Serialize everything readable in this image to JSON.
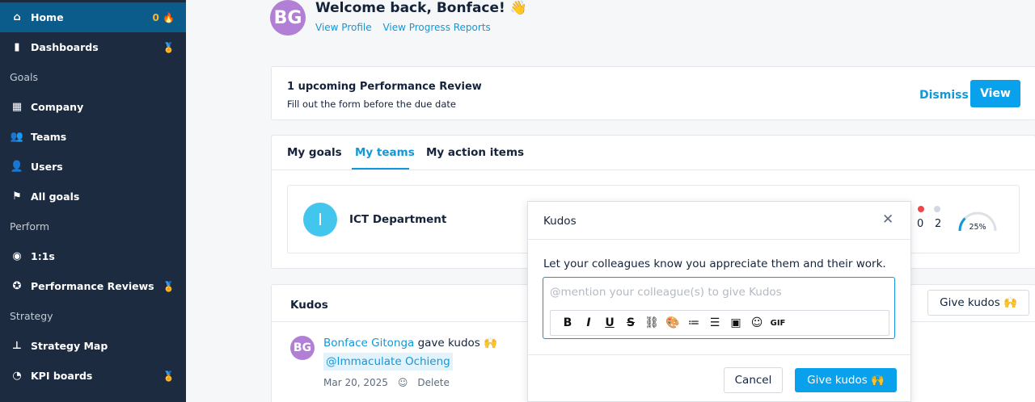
{
  "sidebar": {
    "items": [
      {
        "label": "Home",
        "icon": "home-icon",
        "glyph": "⌂",
        "trail": "0 🔥",
        "active": true
      },
      {
        "label": "Dashboards",
        "icon": "bar-chart-icon",
        "glyph": "▮",
        "trail": "🏅"
      },
      {
        "label": "Company",
        "icon": "building-icon",
        "glyph": "▦"
      },
      {
        "label": "Teams",
        "icon": "team-icon",
        "glyph": "👥"
      },
      {
        "label": "Users",
        "icon": "user-icon",
        "glyph": "👤"
      },
      {
        "label": "All goals",
        "icon": "flag-icon",
        "glyph": "⚑"
      },
      {
        "label": "1:1s",
        "icon": "globe-icon",
        "glyph": "◉"
      },
      {
        "label": "Performance Reviews",
        "icon": "star-icon",
        "glyph": "✪",
        "trail": "🏅"
      },
      {
        "label": "Strategy Map",
        "icon": "sitemap-icon",
        "glyph": "⊥"
      },
      {
        "label": "KPI boards",
        "icon": "gauge-icon",
        "glyph": "◔",
        "trail": "🏅"
      }
    ],
    "sections": [
      "Goals",
      "Perform",
      "Strategy"
    ]
  },
  "header": {
    "avatar_initials": "BG",
    "welcome": "Welcome back, Bonface! 👋",
    "links": [
      "View Profile",
      "View Progress Reports"
    ]
  },
  "review": {
    "title": "1 upcoming Performance Review",
    "subtitle": "Fill out the form before the due date",
    "dismiss": "Dismiss",
    "view": "View"
  },
  "tabs": {
    "items": [
      "My goals",
      "My teams",
      "My action items"
    ],
    "active": "My teams"
  },
  "team": {
    "avatar": "I",
    "name": "ICT Department",
    "count_red": "0",
    "count_grey": "2",
    "progress": "25%",
    "progress_fraction": 0.25
  },
  "kudos": {
    "title": "Kudos",
    "give_button": "Give kudos 🙌",
    "feed": {
      "avatar": "BG",
      "name": "Bonface Gitonga",
      "action": " gave kudos 🙌",
      "mention": "@Immaculate Ochieng",
      "date": "Mar 20, 2025",
      "delete": "Delete"
    }
  },
  "modal": {
    "title": "Kudos",
    "close": "✕",
    "instruction": "Let your colleagues know you appreciate them and their work.",
    "placeholder": "@mention your colleague(s) to give Kudos",
    "cancel": "Cancel",
    "submit": "Give kudos 🙌",
    "toolbar": [
      "B",
      "I",
      "U",
      "S",
      "⛓",
      "🎨",
      "≔",
      "☰",
      "▣",
      "☺",
      "GIF"
    ]
  },
  "colors": {
    "sidebar_bg": "#1c2b40",
    "active_bg": "#0b5c8a",
    "accent": "#0aa1ec",
    "link": "#1298d8"
  }
}
